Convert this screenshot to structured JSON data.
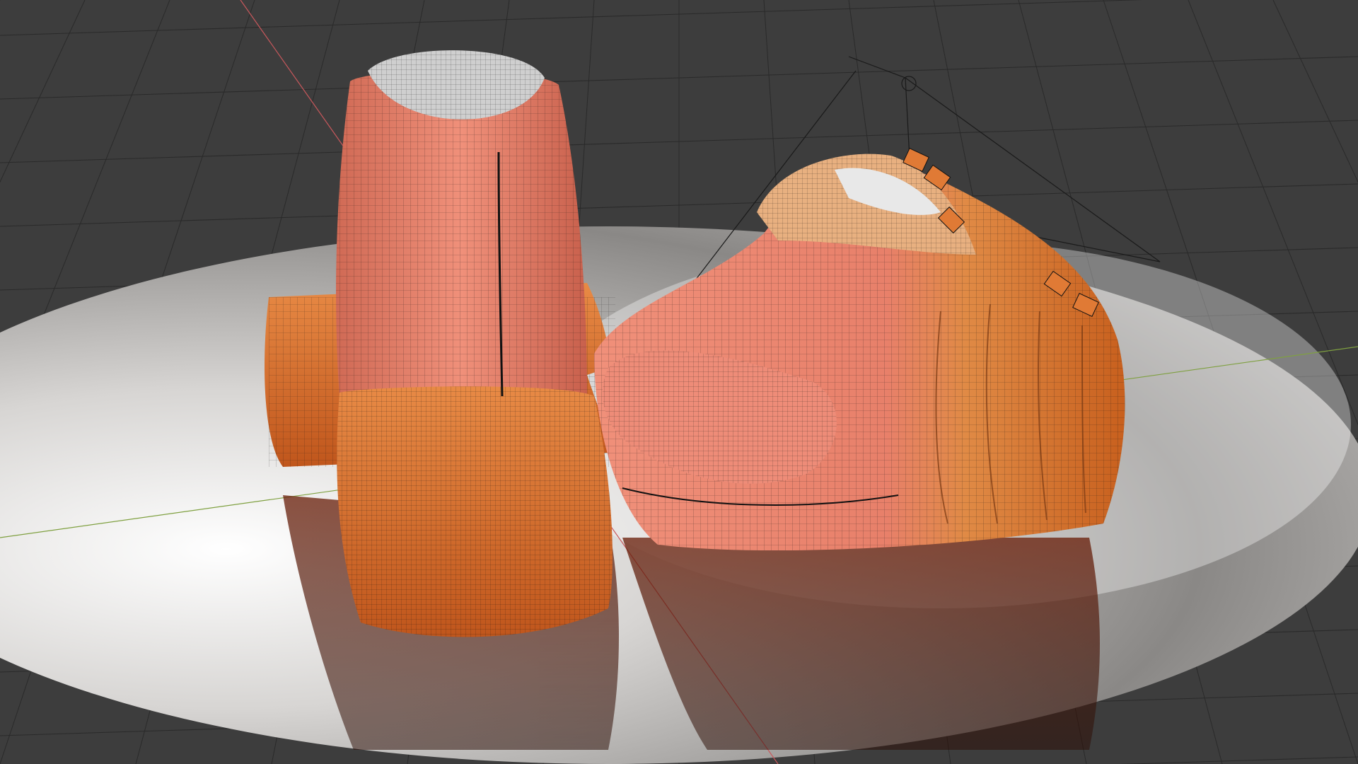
{
  "viewport": {
    "background_color": "#3d3d3d",
    "grid_line_color": "#2a2a2a",
    "x_axis_color": "#c8585c",
    "y_axis_color": "#7fa040",
    "object_wire_color": "#111111"
  },
  "objects": {
    "disc": {
      "name": "reflective-disc",
      "color": "#cfcdcb"
    },
    "boot_left": {
      "name": "boot-rear-view",
      "upper_color": "#e8806a",
      "heel_color": "#e07a35",
      "lining_color": "#cfcfcf"
    },
    "boot_right": {
      "name": "boot-side-view",
      "upper_color": "#e8806a",
      "toe_color": "#e07a35",
      "lining_color": "#d8d8d8"
    },
    "camera": {
      "name": "scene-camera",
      "color": "#1a1a1a"
    }
  }
}
